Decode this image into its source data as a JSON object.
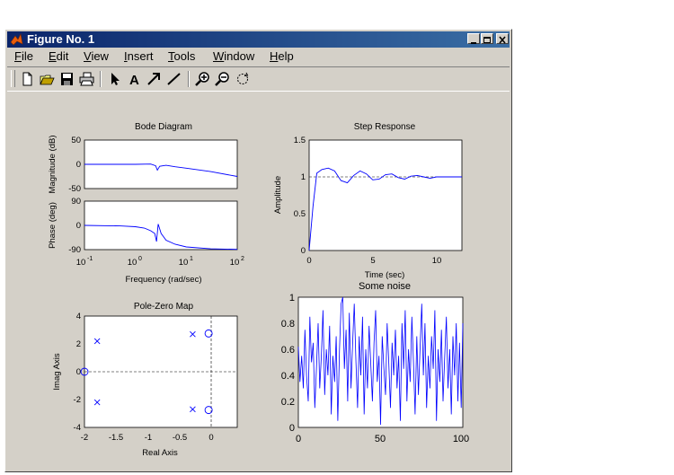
{
  "window": {
    "title": "Figure No. 1"
  },
  "menu": [
    {
      "label": "File",
      "u": "F",
      "rest": "ile"
    },
    {
      "label": "Edit",
      "u": "E",
      "rest": "dit"
    },
    {
      "label": "View",
      "u": "V",
      "rest": "iew"
    },
    {
      "label": "Insert",
      "u": "I",
      "rest": "nsert"
    },
    {
      "label": "Tools",
      "u": "T",
      "rest": "ools"
    },
    {
      "label": "Window",
      "u": "W",
      "rest": "indow"
    },
    {
      "label": "Help",
      "u": "H",
      "rest": "elp"
    }
  ],
  "toolbar": {
    "icons": [
      "new-file-icon",
      "open-folder-icon",
      "save-icon",
      "print-icon",
      "select-arrow-icon",
      "insert-text-icon",
      "insert-arrow-icon",
      "insert-line-icon",
      "zoom-in-icon",
      "zoom-out-icon",
      "rotate-icon"
    ],
    "text_tool_label": "A"
  },
  "chart_data": [
    {
      "type": "line",
      "title": "Bode Diagram",
      "ylabel": "Magnitude (dB)",
      "x_scale": "log",
      "xlim": [
        0.1,
        100
      ],
      "ylim": [
        -50,
        50
      ],
      "yticks": [
        "50",
        "0",
        "-50"
      ],
      "series": [
        {
          "x": [
            0.1,
            0.5,
            1,
            2,
            2.5,
            2.7,
            3,
            4,
            6,
            10,
            30,
            100
          ],
          "values": [
            0,
            0,
            0,
            0.5,
            -3,
            -12,
            -4,
            -2,
            -5,
            -8,
            -15,
            -25
          ]
        }
      ],
      "grid": false
    },
    {
      "type": "line",
      "title": "",
      "ylabel": "Phase (deg)",
      "xlabel": "Frequency (rad/sec)",
      "x_scale": "log",
      "xlim": [
        0.1,
        100
      ],
      "ylim": [
        -90,
        90
      ],
      "yticks": [
        "90",
        "0",
        "-90"
      ],
      "xticks": [
        {
          "base": "10",
          "exp": "-1"
        },
        {
          "base": "10",
          "exp": "0"
        },
        {
          "base": "10",
          "exp": "1"
        },
        {
          "base": "10",
          "exp": "2"
        }
      ],
      "series": [
        {
          "x": [
            0.1,
            0.5,
            1,
            1.5,
            2,
            2.4,
            2.6,
            2.8,
            3.2,
            4,
            6,
            10,
            30,
            100
          ],
          "values": [
            0,
            -2,
            -5,
            -10,
            -20,
            -30,
            -60,
            5,
            -30,
            -55,
            -70,
            -80,
            -87,
            -89
          ]
        }
      ],
      "grid": false
    },
    {
      "type": "line",
      "title": "Step Response",
      "xlabel": "Time (sec)",
      "ylabel": "Amplitude",
      "xlim": [
        0,
        12
      ],
      "ylim": [
        0,
        1.5
      ],
      "xticks": [
        "0",
        "5",
        "10"
      ],
      "yticks": [
        "1.5",
        "1",
        "0.5",
        "0"
      ],
      "reference_line": 1,
      "series": [
        {
          "x": [
            0,
            0.3,
            0.6,
            1.0,
            1.5,
            2.0,
            2.5,
            3.0,
            3.5,
            4.0,
            4.5,
            5.0,
            5.5,
            6.0,
            6.5,
            7.0,
            7.5,
            8.0,
            8.5,
            9.0,
            9.5,
            10,
            11,
            12
          ],
          "values": [
            0,
            0.6,
            1.05,
            1.1,
            1.12,
            1.08,
            0.95,
            0.92,
            1.02,
            1.08,
            1.04,
            0.96,
            0.97,
            1.03,
            1.04,
            0.99,
            0.97,
            1.01,
            1.02,
            1.0,
            0.98,
            1.0,
            1.0,
            1.0
          ]
        }
      ],
      "grid": false
    },
    {
      "type": "scatter",
      "title": "Pole-Zero Map",
      "xlabel": "Real Axis",
      "ylabel": "Imag Axis",
      "xlim": [
        -2,
        0.4
      ],
      "ylim": [
        -4,
        4
      ],
      "xticks": [
        "-2",
        "-1.5",
        "-1",
        "-0.5",
        "0"
      ],
      "yticks": [
        "4",
        "2",
        "0",
        "-2",
        "-4"
      ],
      "poles": [
        [
          -1.8,
          2.2
        ],
        [
          -1.8,
          -2.2
        ],
        [
          -0.3,
          2.7
        ],
        [
          -0.3,
          -2.7
        ]
      ],
      "zeros": [
        [
          -2.0,
          0
        ],
        [
          -0.05,
          2.75
        ],
        [
          -0.05,
          -2.75
        ]
      ],
      "grid": false
    },
    {
      "type": "line",
      "title": "Some noise",
      "xlim": [
        0,
        100
      ],
      "ylim": [
        0,
        1
      ],
      "xticks": [
        "0",
        "50",
        "100"
      ],
      "yticks": [
        "1",
        "0.8",
        "0.6",
        "0.4",
        "0.2",
        "0"
      ],
      "series": [
        {
          "x": [
            0,
            1,
            2,
            3,
            4,
            5,
            6,
            7,
            8,
            9,
            10,
            11,
            12,
            13,
            14,
            15,
            16,
            17,
            18,
            19,
            20,
            21,
            22,
            23,
            24,
            25,
            26,
            27,
            28,
            29,
            30,
            31,
            32,
            33,
            34,
            35,
            36,
            37,
            38,
            39,
            40,
            41,
            42,
            43,
            44,
            45,
            46,
            47,
            48,
            49,
            50,
            51,
            52,
            53,
            54,
            55,
            56,
            57,
            58,
            59,
            60,
            61,
            62,
            63,
            64,
            65,
            66,
            67,
            68,
            69,
            70,
            71,
            72,
            73,
            74,
            75,
            76,
            77,
            78,
            79,
            80,
            81,
            82,
            83,
            84,
            85,
            86,
            87,
            88,
            89,
            90,
            91,
            92,
            93,
            94,
            95,
            96,
            97,
            98,
            99,
            100
          ],
          "values": [
            0.62,
            0.35,
            0.55,
            0.3,
            0.75,
            0.4,
            0.2,
            0.85,
            0.5,
            0.65,
            0.15,
            0.45,
            0.8,
            0.3,
            0.55,
            0.9,
            0.25,
            0.6,
            0.4,
            0.78,
            0.1,
            0.55,
            0.35,
            0.7,
            0.05,
            0.6,
            0.95,
            1.0,
            0.45,
            0.75,
            0.2,
            0.88,
            0.3,
            0.65,
            0.95,
            0.5,
            0.15,
            0.7,
            0.4,
            0.85,
            0.1,
            0.6,
            0.3,
            0.78,
            0.5,
            0.2,
            0.65,
            0.9,
            0.35,
            0.55,
            0.02,
            0.7,
            0.45,
            0.25,
            0.8,
            0.5,
            0.15,
            0.65,
            0.4,
            0.75,
            0.3,
            0.55,
            0.05,
            0.8,
            0.45,
            0.9,
            0.2,
            0.6,
            0.35,
            0.85,
            0.5,
            0.1,
            0.7,
            0.25,
            0.6,
            0.95,
            0.4,
            0.8,
            0.15,
            0.55,
            0.3,
            0.7,
            0.45,
            0.9,
            0.05,
            0.6,
            0.35,
            0.75,
            0.2,
            0.55,
            0.85,
            0.3,
            0.6,
            0.1,
            0.7,
            0.4,
            0.8,
            0.2,
            0.65,
            0.15,
            0.8
          ]
        }
      ],
      "grid": false
    }
  ]
}
